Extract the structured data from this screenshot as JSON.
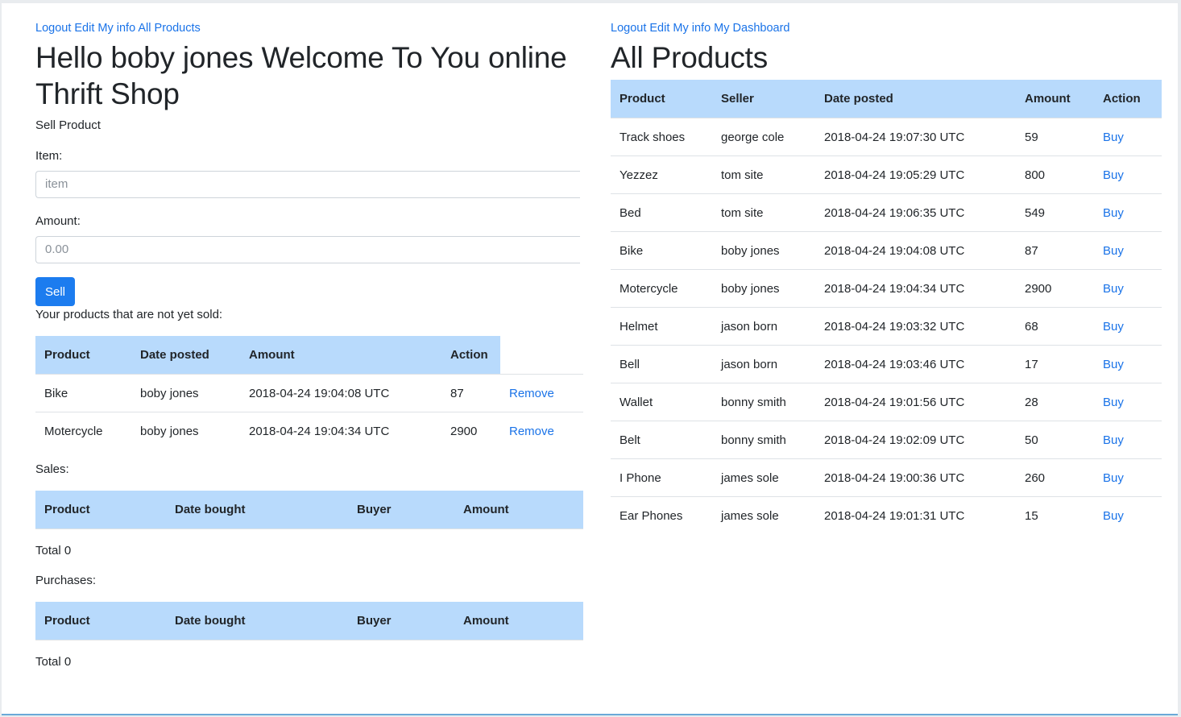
{
  "left": {
    "nav": {
      "logout": "Logout",
      "edit": "Edit My info",
      "all_products": "All Products"
    },
    "title": "Hello boby jones Welcome To You online Thrift Shop",
    "sell_heading": "Sell Product",
    "item_label": "Item:",
    "item_placeholder": "item",
    "amount_label": "Amount:",
    "amount_placeholder": "0.00",
    "sell_button": "Sell",
    "unsold_heading": "Your products that are not yet sold:",
    "unsold_headers": {
      "product": "Product",
      "date": "Date posted",
      "amount": "Amount",
      "action": "Action"
    },
    "unsold_rows": [
      {
        "product": "Bike",
        "seller": "boby jones",
        "date": "2018-04-24 19:04:08 UTC",
        "amount": "87",
        "action": "Remove"
      },
      {
        "product": "Motercycle",
        "seller": "boby jones",
        "date": "2018-04-24 19:04:34 UTC",
        "amount": "2900",
        "action": "Remove"
      }
    ],
    "sales_heading": "Sales:",
    "sales_headers": {
      "product": "Product",
      "date": "Date bought",
      "buyer": "Buyer",
      "amount": "Amount"
    },
    "sales_total": "Total 0",
    "purchases_heading": "Purchases:",
    "purchases_headers": {
      "product": "Product",
      "date": "Date bought",
      "buyer": "Buyer",
      "amount": "Amount"
    },
    "purchases_total": "Total 0"
  },
  "right": {
    "nav": {
      "logout": "Logout",
      "edit": "Edit My info",
      "dashboard": "My Dashboard"
    },
    "title": "All Products",
    "headers": {
      "product": "Product",
      "seller": "Seller",
      "date": "Date posted",
      "amount": "Amount",
      "action": "Action"
    },
    "rows": [
      {
        "product": "Track shoes",
        "seller": "george cole",
        "date": "2018-04-24 19:07:30 UTC",
        "amount": "59",
        "action": "Buy"
      },
      {
        "product": "Yezzez",
        "seller": "tom site",
        "date": "2018-04-24 19:05:29 UTC",
        "amount": "800",
        "action": "Buy"
      },
      {
        "product": "Bed",
        "seller": "tom site",
        "date": "2018-04-24 19:06:35 UTC",
        "amount": "549",
        "action": "Buy"
      },
      {
        "product": "Bike",
        "seller": "boby jones",
        "date": "2018-04-24 19:04:08 UTC",
        "amount": "87",
        "action": "Buy"
      },
      {
        "product": "Motercycle",
        "seller": "boby jones",
        "date": "2018-04-24 19:04:34 UTC",
        "amount": "2900",
        "action": "Buy"
      },
      {
        "product": "Helmet",
        "seller": "jason born",
        "date": "2018-04-24 19:03:32 UTC",
        "amount": "68",
        "action": "Buy"
      },
      {
        "product": "Bell",
        "seller": "jason born",
        "date": "2018-04-24 19:03:46 UTC",
        "amount": "17",
        "action": "Buy"
      },
      {
        "product": "Wallet",
        "seller": "bonny smith",
        "date": "2018-04-24 19:01:56 UTC",
        "amount": "28",
        "action": "Buy"
      },
      {
        "product": "Belt",
        "seller": "bonny smith",
        "date": "2018-04-24 19:02:09 UTC",
        "amount": "50",
        "action": "Buy"
      },
      {
        "product": "I Phone",
        "seller": "james sole",
        "date": "2018-04-24 19:00:36 UTC",
        "amount": "260",
        "action": "Buy"
      },
      {
        "product": "Ear Phones",
        "seller": "james sole",
        "date": "2018-04-24 19:01:31 UTC",
        "amount": "15",
        "action": "Buy"
      }
    ]
  }
}
